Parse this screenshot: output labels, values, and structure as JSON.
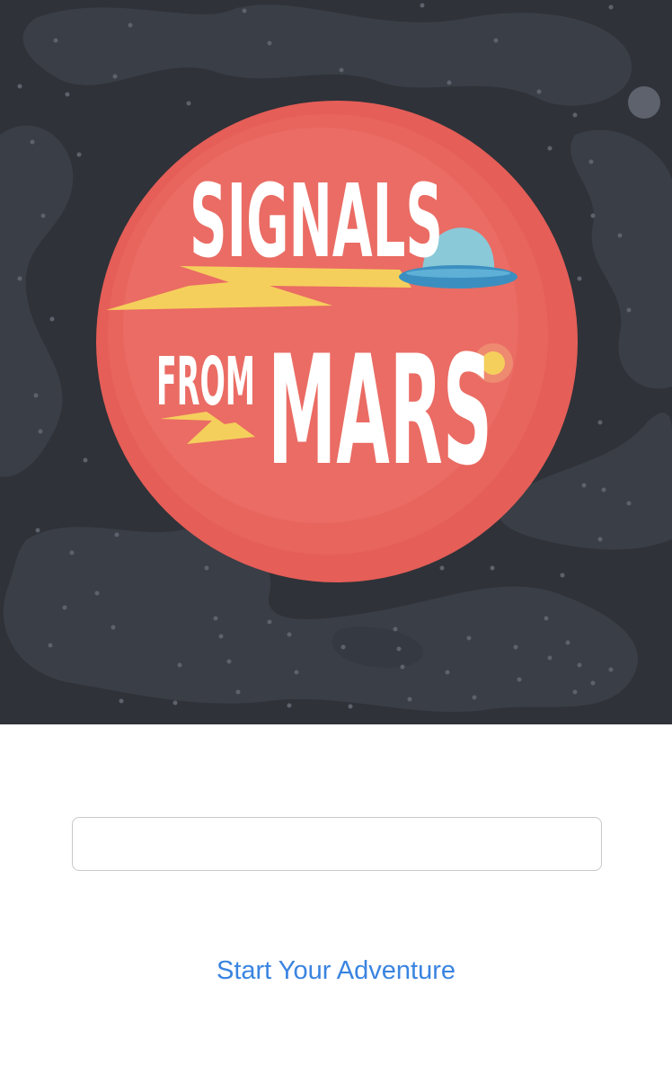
{
  "hero": {
    "logo_line1": "SIGNALS",
    "logo_line2_small": "FROM",
    "logo_line2_big": "MARS",
    "colors": {
      "space": "#2f3238",
      "nebula": "#3a3e46",
      "planet": "#e55e58",
      "planet_light": "#ea6c64",
      "bolt": "#f5cf5c",
      "ufo_dome": "#8ac9d8",
      "ufo_saucer": "#3b8fc0",
      "text": "#ffffff"
    }
  },
  "form": {
    "name_input": {
      "value": "",
      "placeholder": ""
    },
    "start_button_label": "Start Your Adventure"
  }
}
